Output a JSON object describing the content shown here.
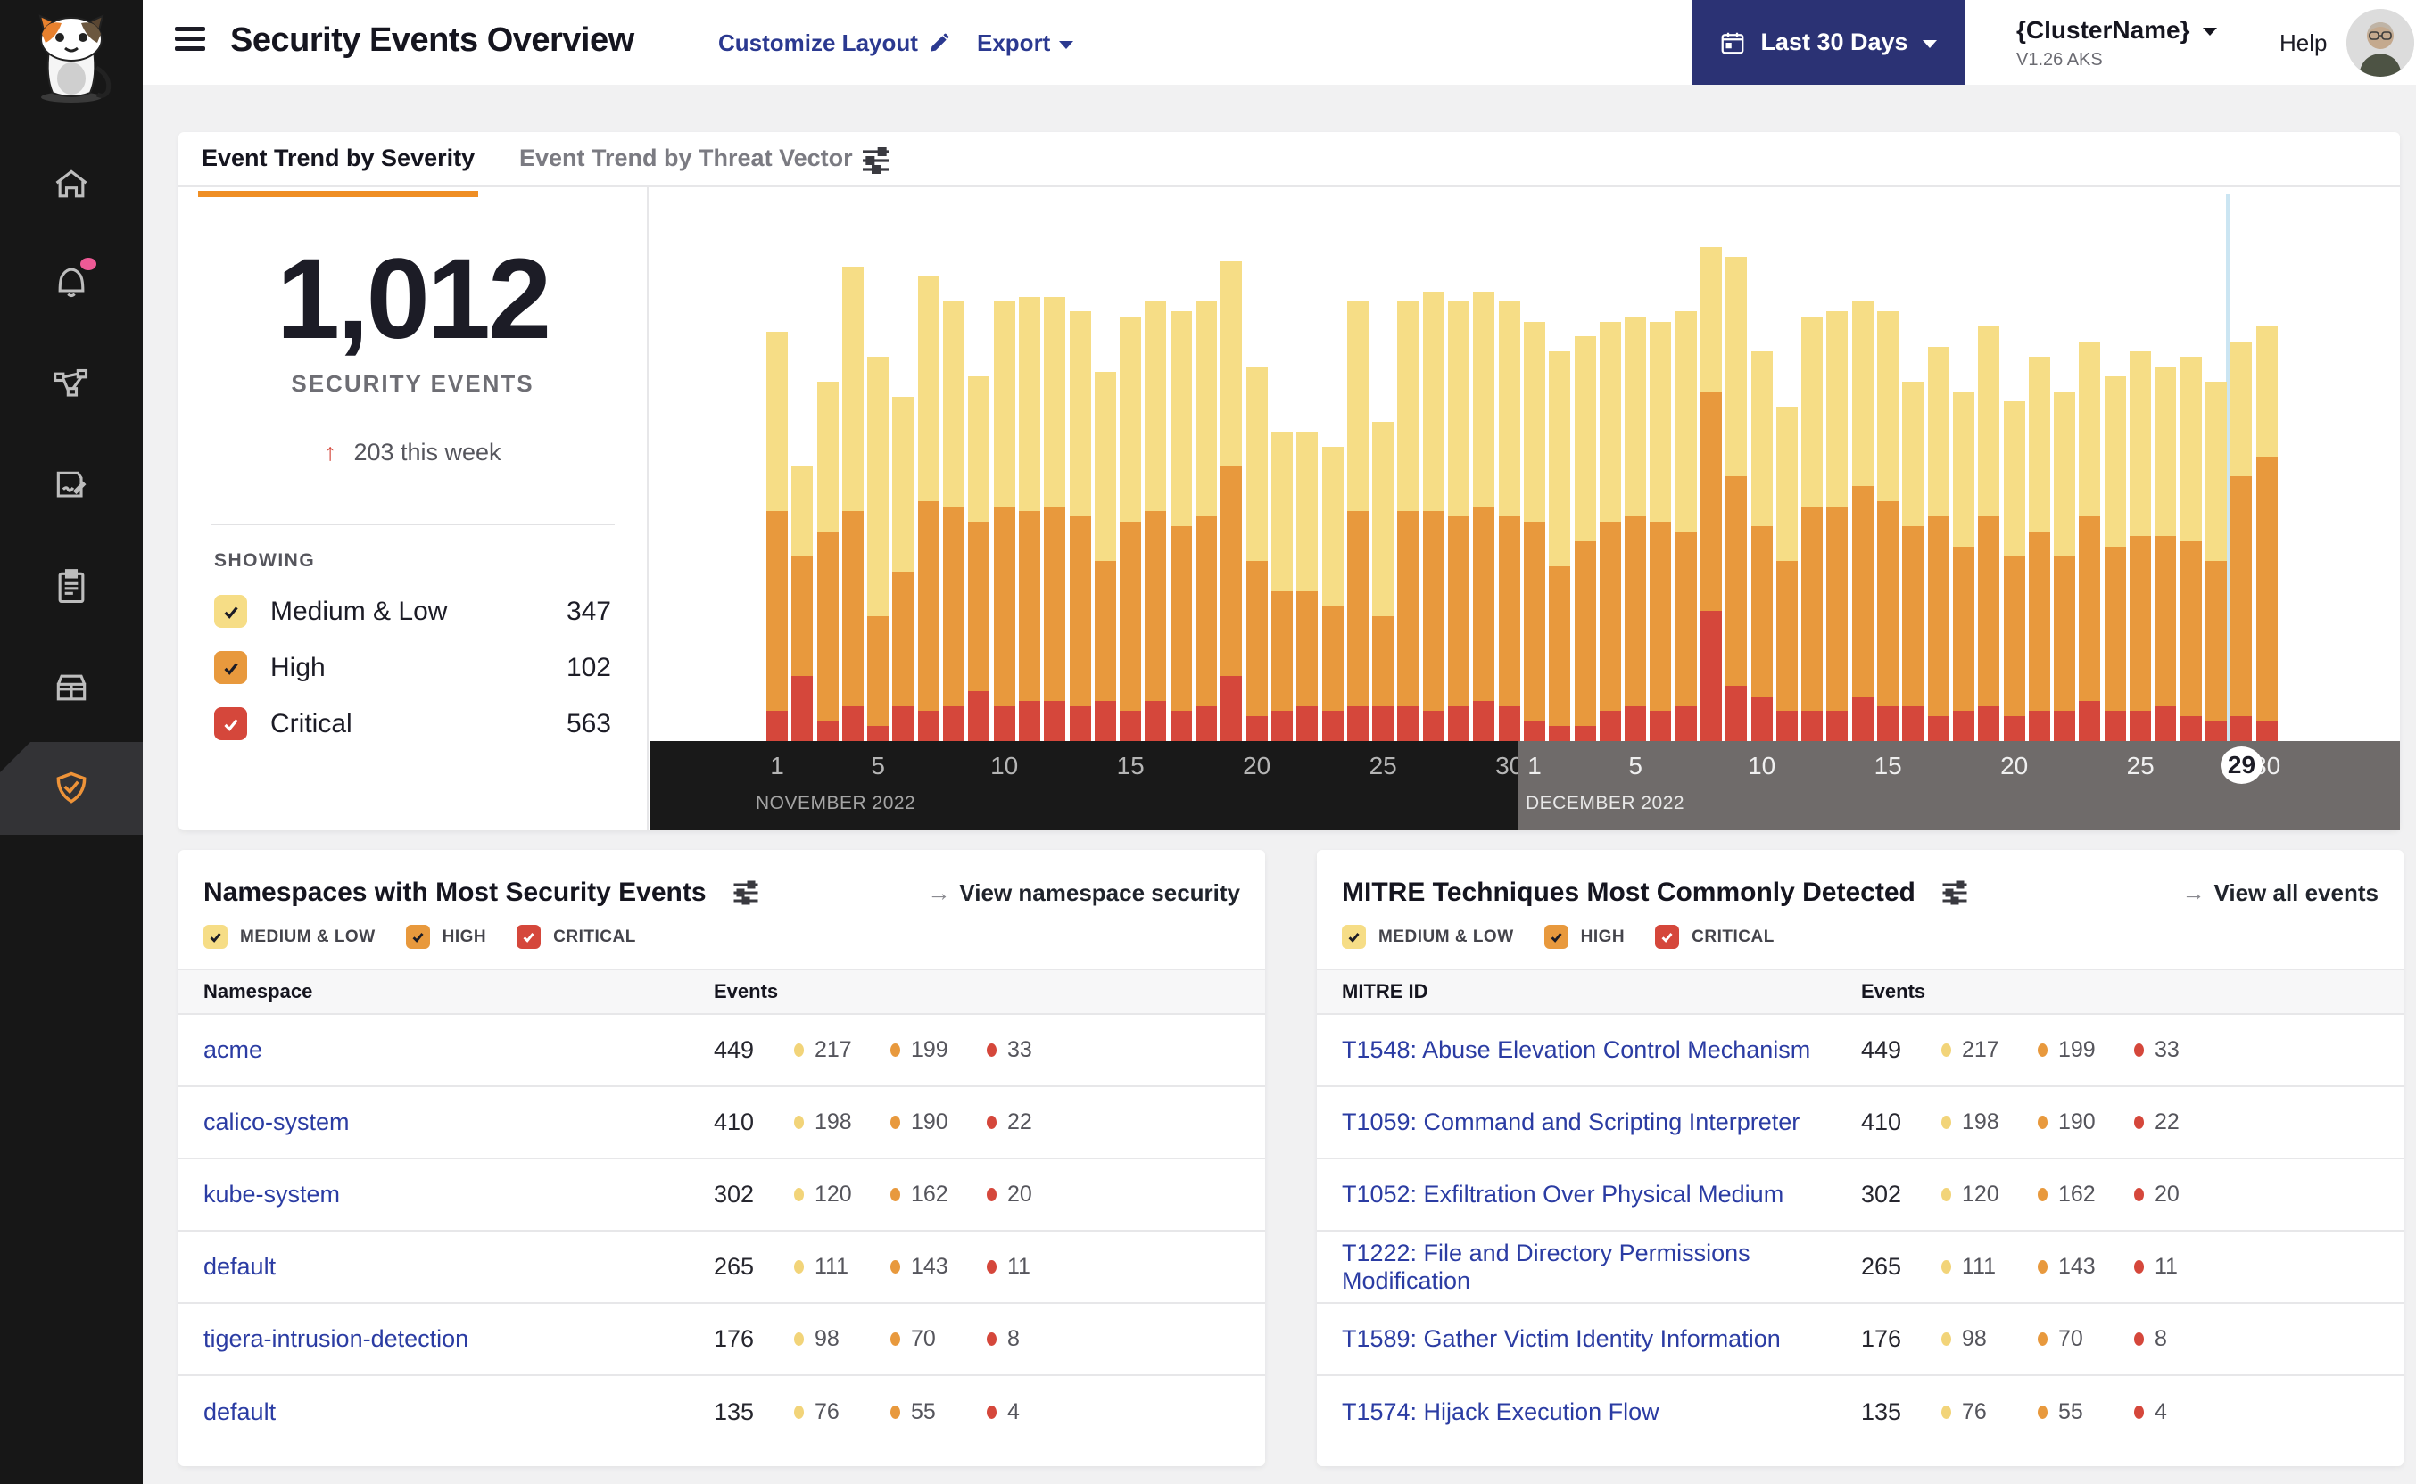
{
  "header": {
    "title": "Security Events Overview",
    "customize_label": "Customize Layout",
    "export_label": "Export",
    "date_range_label": "Last 30 Days",
    "cluster_name": "{ClusterName}",
    "cluster_version": "V1.26 AKS",
    "help_label": "Help"
  },
  "sidebar": {
    "items": [
      "home",
      "alerts",
      "service-graph",
      "policies",
      "compliance-reports",
      "inventory",
      "threat-defense"
    ],
    "active_item": "threat-defense",
    "accent_color": "#EE9338",
    "notification_color": "#EE5A96"
  },
  "tabs": {
    "tab1": "Event Trend by Severity",
    "tab2": "Event Trend by Threat Vector"
  },
  "stat": {
    "total": "1,012",
    "caption": "SECURITY EVENTS",
    "delta_arrow": "↑",
    "delta": "203 this week",
    "showing_label": "SHOWING",
    "severities": [
      {
        "label": "Medium & Low",
        "count": "347",
        "color": "#F6DD86"
      },
      {
        "label": "High",
        "count": "102",
        "color": "#E8993D"
      },
      {
        "label": "Critical",
        "count": "563",
        "color": "#D5473B"
      }
    ]
  },
  "severity_filters": [
    "MEDIUM & LOW",
    "HIGH",
    "CRITICAL"
  ],
  "namespaces_panel": {
    "title": "Namespaces with Most Security Events",
    "link_arrow": "→",
    "link": "View namespace security",
    "col1": "Namespace",
    "col2": "Events",
    "rows": [
      {
        "name": "acme",
        "total": "449",
        "medium": "217",
        "high": "199",
        "critical": "33"
      },
      {
        "name": "calico-system",
        "total": "410",
        "medium": "198",
        "high": "190",
        "critical": "22"
      },
      {
        "name": "kube-system",
        "total": "302",
        "medium": "120",
        "high": "162",
        "critical": "20"
      },
      {
        "name": "default",
        "total": "265",
        "medium": "111",
        "high": "143",
        "critical": "11"
      },
      {
        "name": "tigera-intrusion-detection",
        "total": "176",
        "medium": "98",
        "high": "70",
        "critical": "8"
      },
      {
        "name": "default",
        "total": "135",
        "medium": "76",
        "high": "55",
        "critical": "4"
      }
    ]
  },
  "mitre_panel": {
    "title": "MITRE Techniques Most Commonly Detected",
    "link_arrow": "→",
    "link": "View all events",
    "col1": "MITRE ID",
    "col2": "Events",
    "rows": [
      {
        "name": "T1548: Abuse Elevation Control Mechanism",
        "total": "449",
        "medium": "217",
        "high": "199",
        "critical": "33"
      },
      {
        "name": "T1059: Command and Scripting Interpreter",
        "total": "410",
        "medium": "198",
        "high": "190",
        "critical": "22"
      },
      {
        "name": "T1052: Exfiltration Over Physical Medium",
        "total": "302",
        "medium": "120",
        "high": "162",
        "critical": "20"
      },
      {
        "name": "T1222: File and Directory Permissions Modification",
        "total": "265",
        "medium": "111",
        "high": "143",
        "critical": "11"
      },
      {
        "name": "T1589: Gather Victim Identity Information",
        "total": "176",
        "medium": "98",
        "high": "70",
        "critical": "8"
      },
      {
        "name": "T1574: Hijack Execution Flow",
        "total": "135",
        "medium": "76",
        "high": "55",
        "critical": "4"
      }
    ]
  },
  "chart_data": {
    "type": "bar",
    "subtype": "stacked-daily-severity",
    "unit": "relative height, % of plot (no y-axis shown)",
    "stack_order_bottom_to_top": [
      "critical",
      "high",
      "medium_low"
    ],
    "colors": {
      "medium_low": "#F6DD86",
      "high": "#E8993D",
      "critical": "#D5473B"
    },
    "months": [
      {
        "label": "NOVEMBER 2022",
        "days": 30,
        "ticks": [
          1,
          5,
          10,
          15,
          20,
          25,
          30
        ]
      },
      {
        "label": "DECEMBER 2022",
        "days": 30,
        "ticks": [
          1,
          5,
          10,
          15,
          20,
          25,
          30
        ]
      }
    ],
    "highlight": {
      "month": "DECEMBER 2022",
      "day": 29,
      "label": "29"
    },
    "bars": [
      {
        "c": 6,
        "h": 40,
        "m": 36
      },
      {
        "c": 13,
        "h": 24,
        "m": 18
      },
      {
        "c": 4,
        "h": 38,
        "m": 30
      },
      {
        "c": 7,
        "h": 39,
        "m": 49
      },
      {
        "c": 3,
        "h": 22,
        "m": 52
      },
      {
        "c": 7,
        "h": 27,
        "m": 35
      },
      {
        "c": 6,
        "h": 42,
        "m": 45
      },
      {
        "c": 7,
        "h": 40,
        "m": 41
      },
      {
        "c": 10,
        "h": 34,
        "m": 29
      },
      {
        "c": 7,
        "h": 40,
        "m": 41
      },
      {
        "c": 8,
        "h": 38,
        "m": 43
      },
      {
        "c": 8,
        "h": 39,
        "m": 42
      },
      {
        "c": 7,
        "h": 38,
        "m": 41
      },
      {
        "c": 8,
        "h": 28,
        "m": 38
      },
      {
        "c": 6,
        "h": 38,
        "m": 41
      },
      {
        "c": 8,
        "h": 38,
        "m": 42
      },
      {
        "c": 6,
        "h": 37,
        "m": 43
      },
      {
        "c": 7,
        "h": 38,
        "m": 43
      },
      {
        "c": 13,
        "h": 42,
        "m": 41
      },
      {
        "c": 5,
        "h": 31,
        "m": 39
      },
      {
        "c": 6,
        "h": 24,
        "m": 32
      },
      {
        "c": 7,
        "h": 23,
        "m": 32
      },
      {
        "c": 6,
        "h": 21,
        "m": 32
      },
      {
        "c": 7,
        "h": 39,
        "m": 42
      },
      {
        "c": 7,
        "h": 18,
        "m": 39
      },
      {
        "c": 7,
        "h": 39,
        "m": 42
      },
      {
        "c": 6,
        "h": 40,
        "m": 44
      },
      {
        "c": 7,
        "h": 38,
        "m": 43
      },
      {
        "c": 8,
        "h": 39,
        "m": 43
      },
      {
        "c": 7,
        "h": 38,
        "m": 43
      },
      {
        "c": 4,
        "h": 40,
        "m": 40
      },
      {
        "c": 3,
        "h": 32,
        "m": 43
      },
      {
        "c": 3,
        "h": 37,
        "m": 41
      },
      {
        "c": 6,
        "h": 38,
        "m": 40
      },
      {
        "c": 7,
        "h": 38,
        "m": 40
      },
      {
        "c": 6,
        "h": 38,
        "m": 40
      },
      {
        "c": 7,
        "h": 35,
        "m": 44
      },
      {
        "c": 26,
        "h": 44,
        "m": 29
      },
      {
        "c": 11,
        "h": 42,
        "m": 44
      },
      {
        "c": 9,
        "h": 34,
        "m": 35
      },
      {
        "c": 6,
        "h": 30,
        "m": 31
      },
      {
        "c": 6,
        "h": 41,
        "m": 38
      },
      {
        "c": 6,
        "h": 41,
        "m": 39
      },
      {
        "c": 9,
        "h": 42,
        "m": 37
      },
      {
        "c": 7,
        "h": 41,
        "m": 38
      },
      {
        "c": 7,
        "h": 36,
        "m": 29
      },
      {
        "c": 5,
        "h": 40,
        "m": 34
      },
      {
        "c": 6,
        "h": 33,
        "m": 31
      },
      {
        "c": 7,
        "h": 38,
        "m": 38
      },
      {
        "c": 5,
        "h": 32,
        "m": 31
      },
      {
        "c": 6,
        "h": 36,
        "m": 35
      },
      {
        "c": 6,
        "h": 31,
        "m": 33
      },
      {
        "c": 8,
        "h": 37,
        "m": 35
      },
      {
        "c": 6,
        "h": 33,
        "m": 34
      },
      {
        "c": 6,
        "h": 35,
        "m": 37
      },
      {
        "c": 7,
        "h": 34,
        "m": 34
      },
      {
        "c": 5,
        "h": 35,
        "m": 37
      },
      {
        "c": 4,
        "h": 32,
        "m": 36
      },
      {
        "c": 5,
        "h": 48,
        "m": 27
      },
      {
        "c": 4,
        "h": 53,
        "m": 26
      }
    ]
  }
}
